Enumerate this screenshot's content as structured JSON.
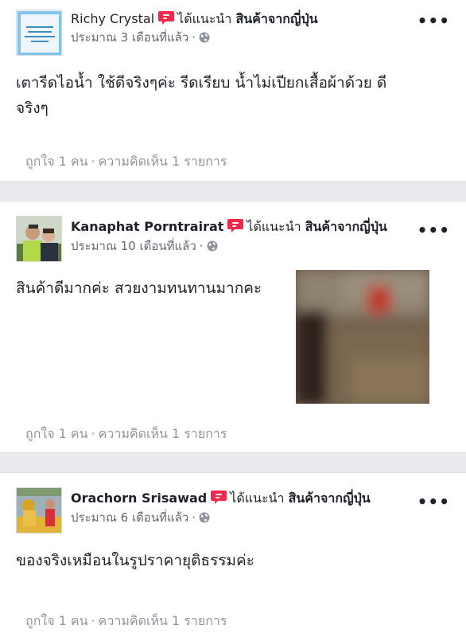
{
  "posts": [
    {
      "author": "Richy Crystal",
      "recommend_text": "ได้แนะนำ",
      "page_name": "สินค้าจากญี่ปุ่น",
      "time": "ประมาณ 3 เดือนที่แล้ว",
      "separator": "·",
      "more": "•••",
      "body_line1": "เตารีดไอน้ำ ใช้ดีจริงๆค่ะ รีดเรียบ น้ำไม่เปียกเสื้อผ้าด้วย ดี",
      "body_line2": "จริงๆ",
      "likes": "ถูกใจ 1 คน",
      "comments": "ความคิดเห็น 1 รายการ"
    },
    {
      "author": "Kanaphat Porntrairat",
      "recommend_text": "ได้แนะนำ",
      "page_name": "สินค้าจากญี่ปุ่น",
      "time": "ประมาณ 10 เดือนที่แล้ว",
      "separator": "·",
      "more": "•••",
      "body_line1": "สินค้าดีมากค่ะ สวยงามทนทานมากคะ",
      "likes": "ถูกใจ 1 คน",
      "comments": "ความคิดเห็น 1 รายการ"
    },
    {
      "author": "Orachorn Srisawad",
      "recommend_text": "ได้แนะนำ",
      "page_name": "สินค้าจากญี่ปุ่น",
      "time": "ประมาณ 6 เดือนที่แล้ว",
      "separator": "·",
      "more": "•••",
      "body_line1": "ของจริงเหมือนในรูปราคายุติธรรมค่ะ",
      "likes": "ถูกใจ 1 คน",
      "comments": "ความคิดเห็น 1 รายการ"
    }
  ],
  "colors": {
    "recommend_badge": "#f02849",
    "divider": "#e9ebee",
    "meta_text": "#90949c"
  },
  "icons": {
    "recommend": "recommend-bubble-icon",
    "globe": "globe-icon",
    "more": "more-options-icon"
  }
}
